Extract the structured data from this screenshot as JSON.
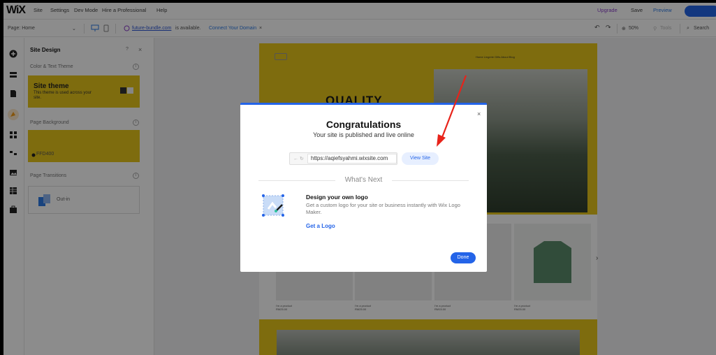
{
  "topbar": {
    "logo": "WiX",
    "menu": [
      "Site",
      "Settings",
      "Dev Mode",
      "Hire a Professional",
      "Help"
    ],
    "upgrade": "Upgrade",
    "save": "Save",
    "preview": "Preview"
  },
  "bar2": {
    "page_label": "Page: Home",
    "domain_link": "future-bundle.com",
    "domain_text": "is available.",
    "connect": "Connect Your Domain",
    "zoom": "50%",
    "tools": "Tools",
    "search": "Search"
  },
  "panel": {
    "title": "Site Design",
    "help": "?",
    "close": "×",
    "color_theme": "Color & Text Theme",
    "theme_title": "Site theme",
    "theme_desc": "This theme is used across your site.",
    "page_background": "Page Background",
    "bg_color": "FFD400",
    "page_transitions": "Page Transitions",
    "transition": "Out-in"
  },
  "site": {
    "quality": "QUALITY",
    "nav": "Home  Lingerie  Gifts  About  Blog",
    "products": [
      {
        "label": "I'm a product",
        "price": "RM25.00"
      },
      {
        "label": "I'm a product",
        "price": "RM25.00"
      },
      {
        "label": "I'm a product",
        "price": "RM15.00"
      },
      {
        "label": "I'm a product",
        "price": "RM25.00"
      }
    ]
  },
  "modal": {
    "close": "×",
    "title": "Congratulations",
    "subtitle": "Your site is published and live online",
    "url": "https://aqiefsyahmi.wixsite.com",
    "view_site": "View Site",
    "whats_next": "What's Next",
    "logo_title": "Design your own logo",
    "logo_desc": "Get a custom logo for your site or business instantly with Wix Logo Maker.",
    "get_logo": "Get a Logo",
    "done": "Done"
  },
  "colors": {
    "accent": "#2464e8",
    "site_yellow": "#e6c51a",
    "annotation_arrow": "#e8231a"
  }
}
